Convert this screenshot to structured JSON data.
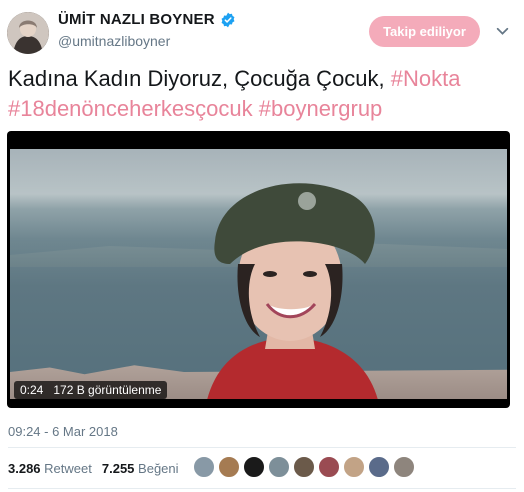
{
  "header": {
    "display_name": "ÜMİT NAZLI BOYNER",
    "handle": "@umitnazliboyner",
    "follow_label": "Takip ediliyor"
  },
  "tweet": {
    "text_plain": "Kadına Kadın Diyoruz, Çocuğa Çocuk, ",
    "hashtag1": "#Nokta",
    "hashtag2": "#18denönceherkesçocuk",
    "hashtag3": "#boynergrup"
  },
  "video": {
    "time": "0:24",
    "views": "172 B görüntülenme"
  },
  "timestamp": "09:24 - 6 Mar 2018",
  "stats": {
    "retweets_count": "3.286",
    "retweets_label": "Retweet",
    "likes_count": "7.255",
    "likes_label": "Beğeni"
  },
  "colors": {
    "accent_pink": "#f4abba",
    "hashtag": "#e8849a",
    "verified": "#1da1f2"
  },
  "icons": {
    "verified": "verified-badge-icon",
    "caret": "chevron-down-icon"
  }
}
